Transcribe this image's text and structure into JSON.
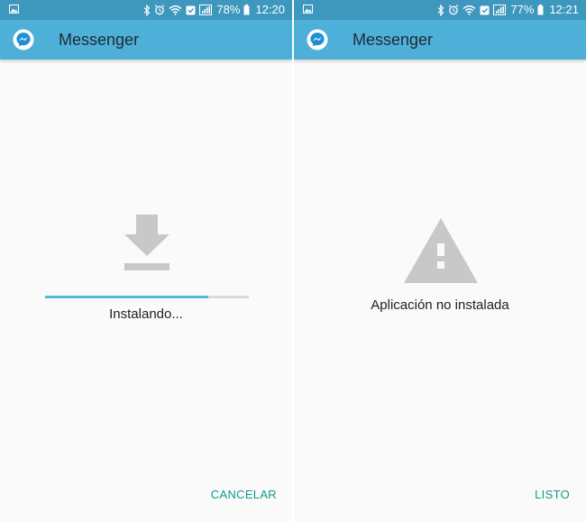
{
  "left_screen": {
    "status_bar": {
      "battery_percent": "78%",
      "time": "12:20"
    },
    "app_bar": {
      "title": "Messenger",
      "icon": "messenger-icon"
    },
    "install": {
      "graphic_icon": "download-icon",
      "progress": 0.8,
      "status_text": "Instalando...",
      "cancel_label": "CANCELAR"
    }
  },
  "right_screen": {
    "status_bar": {
      "battery_percent": "77%",
      "time": "12:21"
    },
    "app_bar": {
      "title": "Messenger",
      "icon": "messenger-icon"
    },
    "result": {
      "graphic_icon": "warning-icon",
      "message_text": "Aplicación no instalada",
      "done_label": "LISTO"
    }
  },
  "colors": {
    "status_bar": "#3e97bd",
    "app_bar": "#4eb0d9",
    "progress": "#56b8d6",
    "accent_button": "#0d9c8a",
    "graphic_gray": "#c8c8c8"
  }
}
